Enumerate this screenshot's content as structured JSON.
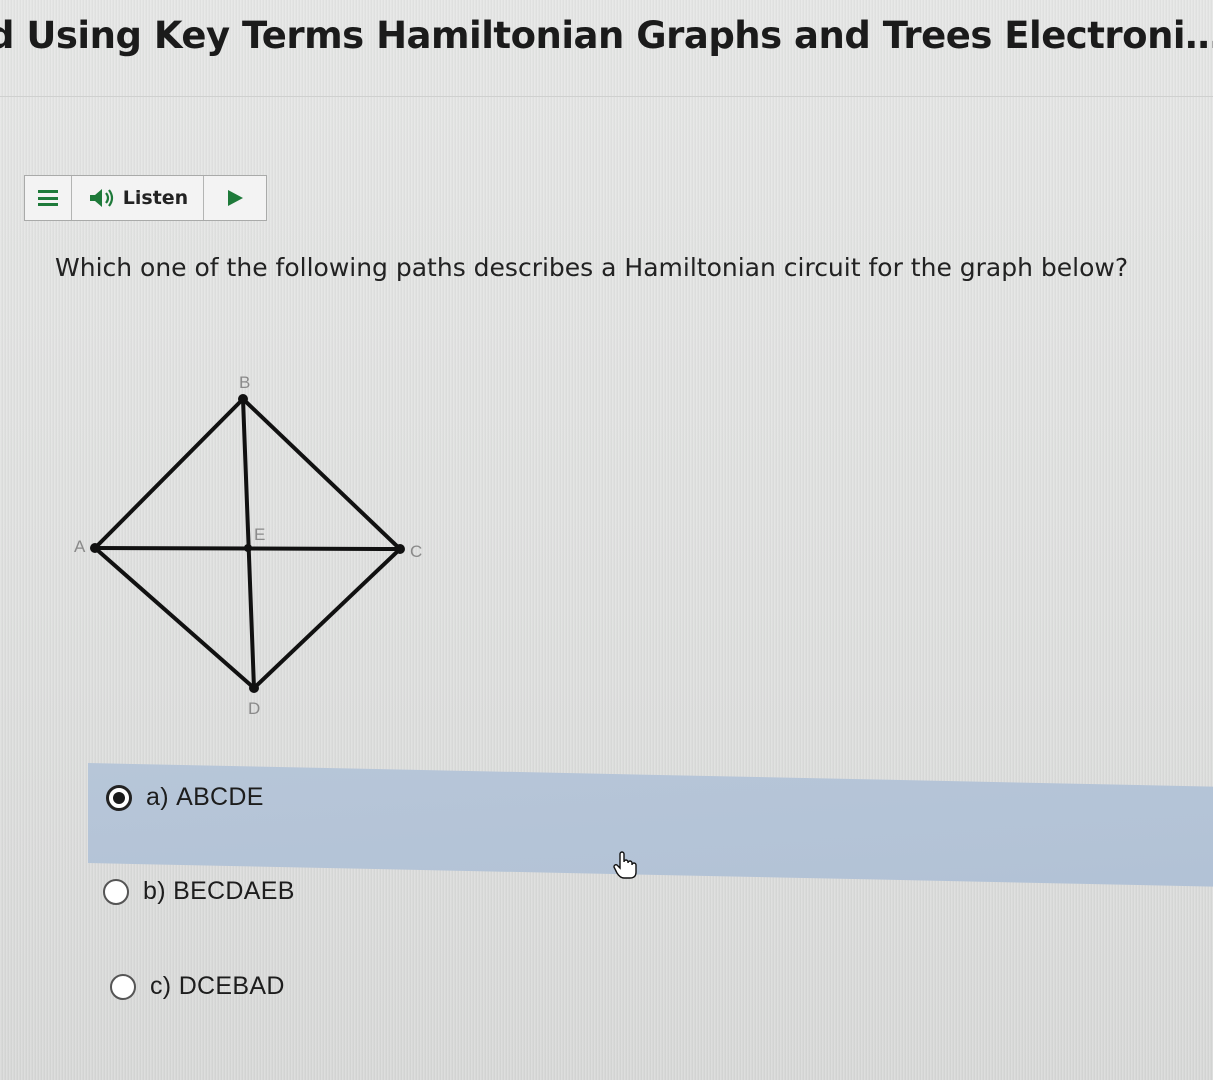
{
  "page": {
    "title": "d Using Key Terms Hamiltonian Graphs and Trees Electronic Wor..."
  },
  "listen_bar": {
    "menu_icon": "menu-icon",
    "speaker_icon": "speaker-icon",
    "listen_label": "Listen",
    "play_icon": "play-icon"
  },
  "question": {
    "text": "Which one of the following paths describes a Hamiltonian circuit for the graph below?"
  },
  "graph": {
    "vertices": [
      "B",
      "A",
      "E",
      "C",
      "D"
    ],
    "edges": [
      [
        "A",
        "B"
      ],
      [
        "B",
        "C"
      ],
      [
        "C",
        "D"
      ],
      [
        "D",
        "A"
      ],
      [
        "A",
        "C"
      ],
      [
        "B",
        "D"
      ]
    ]
  },
  "options": [
    {
      "letter": "a)",
      "text": "ABCDE",
      "selected": true
    },
    {
      "letter": "b)",
      "text": "BECDAEB",
      "selected": false
    },
    {
      "letter": "c)",
      "text": "DCEBAD",
      "selected": false
    }
  ],
  "colors": {
    "accent_green": "#1e7a3a",
    "selected_highlight": "#b4c4d7",
    "page_background": "#e3e4e3"
  }
}
